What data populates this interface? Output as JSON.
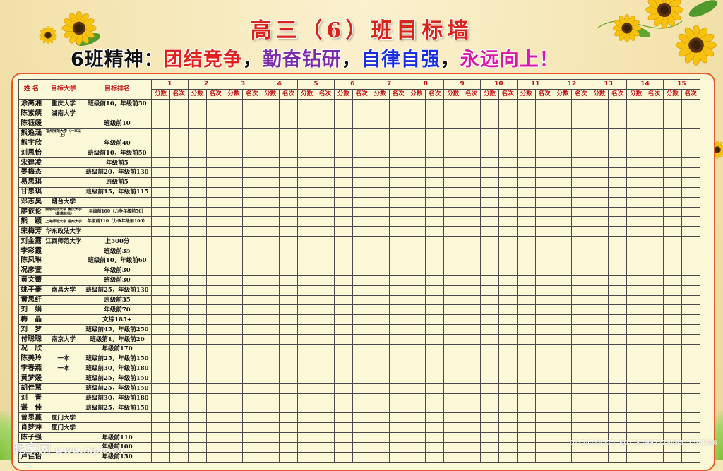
{
  "title": "高三（6）班目标墙",
  "motto": {
    "label": "6班精神：",
    "p1": "团结竞争",
    "p2": "勤奋钻研",
    "p3": "自律自强",
    "p4": "永远向上",
    "sep": "，",
    "end": "！"
  },
  "table": {
    "col_name": "姓 名",
    "col_uni": "目标大学",
    "col_rank": "目标排名",
    "exam_numbers": [
      "1",
      "2",
      "3",
      "4",
      "5",
      "6",
      "7",
      "8",
      "9",
      "10",
      "11",
      "12",
      "13",
      "14",
      "15"
    ],
    "sub_score": "分数",
    "sub_rank": "名次",
    "rows": [
      {
        "name": "涂高湘",
        "uni": "重庆大学",
        "rank": "班级前10，年级前50"
      },
      {
        "name": "陈紫姨",
        "uni": "湖南大学",
        "rank": ""
      },
      {
        "name": "陈钰媛",
        "uni": "",
        "rank": "班级前10"
      },
      {
        "name": "熊逸涵",
        "uni": "福州师范大学（一本以上）",
        "rank": ""
      },
      {
        "name": "熊宇欣",
        "uni": "",
        "rank": "年级前40"
      },
      {
        "name": "刘思怡",
        "uni": "",
        "rank": "班级前10，年级前50"
      },
      {
        "name": "宋建凌",
        "uni": "",
        "rank": "年级前5"
      },
      {
        "name": "晏梅杰",
        "uni": "",
        "rank": "班级前20，年级前130"
      },
      {
        "name": "易思琪",
        "uni": "",
        "rank": "班级前5"
      },
      {
        "name": "甘思琪",
        "uni": "",
        "rank": "班级前15，年级前115"
      },
      {
        "name": "邓志昊",
        "uni": "烟台大学",
        "rank": ""
      },
      {
        "name": "廖依伦",
        "uni": "西南政法大学 重庆大学（最高目标）",
        "rank": "年级前100（力争年级前50）"
      },
      {
        "name": "熊　颖",
        "uni": "上海师范大学 福州大学",
        "rank": "年级前110（力争年级前100）"
      },
      {
        "name": "宋梅芳",
        "uni": "华东政法大学",
        "rank": ""
      },
      {
        "name": "刘金露",
        "uni": "江西师范大学",
        "rank": "上500分"
      },
      {
        "name": "李彩霞",
        "uni": "",
        "rank": "班级前35"
      },
      {
        "name": "陈凤琳",
        "uni": "",
        "rank": "班级前10，年级前60"
      },
      {
        "name": "况彦萱",
        "uni": "",
        "rank": "年级前30"
      },
      {
        "name": "黄文蕾",
        "uni": "",
        "rank": "班级前30"
      },
      {
        "name": "姚子豪",
        "uni": "南昌大学",
        "rank": "班级前25，年级前130"
      },
      {
        "name": "黄思纤",
        "uni": "",
        "rank": "班级前35"
      },
      {
        "name": "刘　娟",
        "uni": "",
        "rank": "年级前70"
      },
      {
        "name": "梅　晶",
        "uni": "",
        "rank": "文综185+"
      },
      {
        "name": "刘　梦",
        "uni": "",
        "rank": "班级前45，年级前250"
      },
      {
        "name": "付聪聪",
        "uni": "南京大学",
        "rank": "班级第1，年级前20"
      },
      {
        "name": "况　欣",
        "uni": "",
        "rank": "年级前170"
      },
      {
        "name": "陈美玲",
        "uni": "一本",
        "rank": "班级前25，年级前150"
      },
      {
        "name": "李春燕",
        "uni": "一本",
        "rank": "班级前30，年级前180"
      },
      {
        "name": "黄梦媛",
        "uni": "",
        "rank": "班级前25，年级前150"
      },
      {
        "name": "胡佳慧",
        "uni": "",
        "rank": "班级前25，年级前150"
      },
      {
        "name": "刘　青",
        "uni": "",
        "rank": "班级前30，年级前180"
      },
      {
        "name": "谌　佳",
        "uni": "",
        "rank": "班级前25，年级前150"
      },
      {
        "name": "曾思蔓",
        "uni": "厦门大学",
        "rank": ""
      },
      {
        "name": "肖梦萍",
        "uni": "厦门大学",
        "rank": ""
      },
      {
        "name": "陈子强",
        "uni": "",
        "rank": "年级前110"
      },
      {
        "name": "",
        "uni": "",
        "rank": "年级前100"
      },
      {
        "name": "卢佳怡",
        "uni": "",
        "rank": "年级前150"
      }
    ]
  },
  "watermark": {
    "brand": "昵享网",
    "url": "www.nipic.cn",
    "id": "ID:24739575 NO:20190722090517568000"
  },
  "colors": {
    "title": "#d8251b",
    "frame_border": "#e65a2a",
    "header_text": "#c01818",
    "grid_line": "#4a4a4a"
  }
}
